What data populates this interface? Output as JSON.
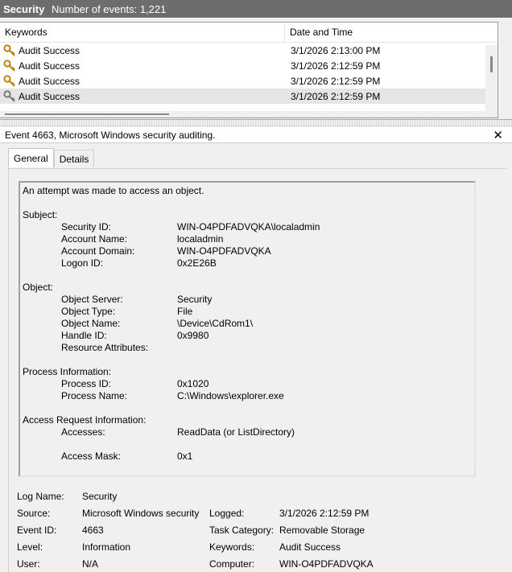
{
  "header": {
    "title": "Security",
    "count_text": "Number of events: 1,221"
  },
  "list": {
    "col_keywords": "Keywords",
    "col_datetime": "Date and Time",
    "rows": [
      {
        "keyword": "Audit Success",
        "datetime": "3/1/2026 2:13:00 PM"
      },
      {
        "keyword": "Audit Success",
        "datetime": "3/1/2026 2:12:59 PM"
      },
      {
        "keyword": "Audit Success",
        "datetime": "3/1/2026 2:12:59 PM"
      },
      {
        "keyword": "Audit Success",
        "datetime": "3/1/2026 2:12:59 PM"
      }
    ],
    "icon": "key-icon"
  },
  "detail": {
    "title": "Event 4663, Microsoft Windows security auditing.",
    "close_glyph": "✕",
    "tabs": [
      "General",
      "Details"
    ],
    "description": {
      "intro": "An attempt was made to access an object.",
      "subject": {
        "heading": "Subject:",
        "items": [
          {
            "label": "Security ID:",
            "value": "WIN-O4PDFADVQKA\\localadmin"
          },
          {
            "label": "Account Name:",
            "value": "localadmin"
          },
          {
            "label": "Account Domain:",
            "value": "WIN-O4PDFADVQKA"
          },
          {
            "label": "Logon ID:",
            "value": "0x2E26B"
          }
        ]
      },
      "object": {
        "heading": "Object:",
        "items": [
          {
            "label": "Object Server:",
            "value": "Security"
          },
          {
            "label": "Object Type:",
            "value": "File"
          },
          {
            "label": "Object Name:",
            "value": "\\Device\\CdRom1\\"
          },
          {
            "label": "Handle ID:",
            "value": "0x9980"
          },
          {
            "label": "Resource Attributes:",
            "value": ""
          }
        ]
      },
      "process": {
        "heading": "Process Information:",
        "items": [
          {
            "label": "Process ID:",
            "value": "0x1020"
          },
          {
            "label": "Process Name:",
            "value": "C:\\Windows\\explorer.exe"
          }
        ]
      },
      "access": {
        "heading": "Access Request Information:",
        "items": [
          {
            "label": "Accesses:",
            "value": "ReadData (or ListDirectory)"
          },
          {
            "label": "Access Mask:",
            "value": "0x1"
          }
        ]
      }
    },
    "meta": {
      "log_name": {
        "label": "Log Name:",
        "value": "Security"
      },
      "source": {
        "label": "Source:",
        "value": "Microsoft Windows security"
      },
      "logged": {
        "label": "Logged:",
        "value": "3/1/2026 2:12:59 PM"
      },
      "event_id": {
        "label": "Event ID:",
        "value": "4663"
      },
      "task_category": {
        "label": "Task Category:",
        "value": "Removable Storage"
      },
      "level": {
        "label": "Level:",
        "value": "Information"
      },
      "keywords": {
        "label": "Keywords:",
        "value": "Audit Success"
      },
      "user": {
        "label": "User:",
        "value": "N/A"
      },
      "computer": {
        "label": "Computer:",
        "value": "WIN-O4PDFADVQKA"
      }
    }
  }
}
